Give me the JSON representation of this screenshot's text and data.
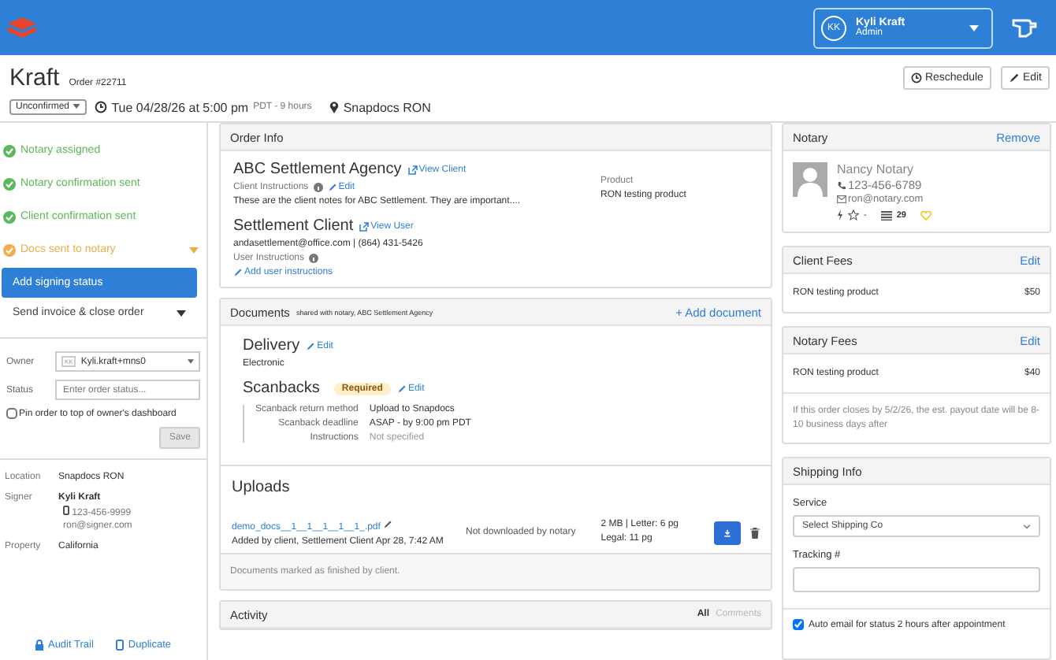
{
  "header": {
    "user_initials": "KK",
    "user_name": "Kyli Kraft",
    "user_role": "Admin"
  },
  "order": {
    "title": "Kraft",
    "number": "Order #22711",
    "status": "Unconfirmed",
    "datetime": "Tue 04/28/26 at 5:00 pm",
    "timezone": "PDT - 9 hours",
    "location": "Snapdocs RON"
  },
  "actions": [
    "Reschedule",
    "Edit"
  ],
  "steps": [
    {
      "label": "Notary assigned",
      "kind": "done"
    },
    {
      "label": "Notary confirmation sent",
      "kind": "done"
    },
    {
      "label": "Client confirmation sent",
      "kind": "done"
    },
    {
      "label": "Docs sent to notary",
      "kind": "current"
    }
  ],
  "primary_button": "Add signing status",
  "close_menu": "Send invoice & close order",
  "owner_form": {
    "owner_label": "Owner",
    "owner_initials": "KK",
    "owner_value": "Kyli.kraft+mns0",
    "status_label": "Status",
    "status_placeholder": "Enter order status...",
    "pin_label": "Pin order to top of owner's dashboard",
    "pin_checked": false,
    "save": "Save"
  },
  "details": {
    "location_label": "Location",
    "location": "Snapdocs RON",
    "signer_label": "Signer",
    "signer_name": "Kyli Kraft",
    "signer_phone": "123-456-9999",
    "signer_email": "ron@signer.com",
    "property_label": "Property",
    "property": "California"
  },
  "footer_links": [
    "Audit Trail",
    "Duplicate"
  ],
  "order_info": {
    "title": "Order Info",
    "client": "ABC Settlement Agency",
    "view_client": "View Client",
    "client_instructions_label": "Client Instructions",
    "edit": "Edit",
    "client_notes": "These are the client notes for ABC Settlement. They are important....",
    "user": "Settlement Client",
    "view_user": "View User",
    "user_contact": "andasettlement@office.com | (864) 431-5426",
    "user_instructions_label": "User Instructions",
    "add_user_instructions": "Add user instructions",
    "product_label": "Product",
    "product": "RON testing product"
  },
  "documents": {
    "title": "Documents",
    "subtitle": "shared with notary, ABC Settlement Agency",
    "add": "+ Add document",
    "delivery_title": "Delivery",
    "delivery_edit": "Edit",
    "delivery": "Electronic",
    "scanbacks_title": "Scanbacks",
    "scanbacks_badge": "Required",
    "scanbacks_edit": "Edit",
    "scanback_rows": [
      {
        "label": "Scanback return method",
        "value": "Upload to Snapdocs",
        "muted": false
      },
      {
        "label": "Scanback deadline",
        "value": "ASAP - by 9:00 pm PDT",
        "muted": false
      },
      {
        "label": "Instructions",
        "value": "Not specified",
        "muted": true
      }
    ],
    "uploads_title": "Uploads",
    "file_name": "demo_docs__1__1__1__1__1_.pdf",
    "file_added": "Added by client, Settlement Client Apr 28, 7:42 AM",
    "file_status": "Not downloaded by notary",
    "file_size": "2 MB | Letter: 6 pg Legal: 11 pg",
    "footer": "Documents marked as finished by client."
  },
  "activity": {
    "title": "Activity",
    "tabs": [
      {
        "label": "All",
        "selected": true
      },
      {
        "label": "Comments",
        "selected": false
      }
    ]
  },
  "notary": {
    "title": "Notary",
    "remove": "Remove",
    "name": "Nancy Notary",
    "phone": "123-456-6789",
    "email": "ron@notary.com",
    "rating": "-",
    "count": "29"
  },
  "client_fees": {
    "title": "Client Fees",
    "edit": "Edit",
    "items": [
      {
        "name": "RON testing product",
        "amount": "$50"
      }
    ]
  },
  "notary_fees": {
    "title": "Notary Fees",
    "edit": "Edit",
    "items": [
      {
        "name": "RON testing product",
        "amount": "$40"
      }
    ],
    "note": "If this order closes by 5/2/26, the est. payout date will be 8-10 business days after"
  },
  "shipping": {
    "title": "Shipping Info",
    "service_label": "Service",
    "service_placeholder": "Select Shipping Co",
    "tracking_label": "Tracking #",
    "auto_email_label": "Auto email for status 2 hours after appointment",
    "auto_email_checked": true
  }
}
